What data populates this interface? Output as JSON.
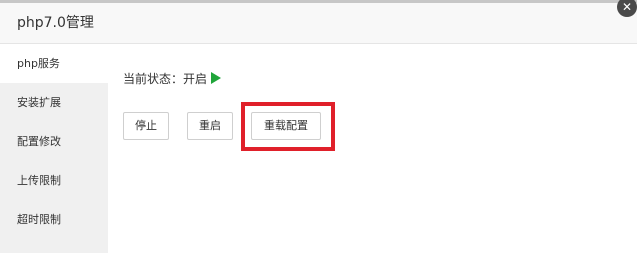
{
  "window": {
    "title": "php7.0管理",
    "close_glyph": "✕"
  },
  "sidebar": {
    "items": [
      {
        "label": "php服务",
        "active": true
      },
      {
        "label": "安装扩展",
        "active": false
      },
      {
        "label": "配置修改",
        "active": false
      },
      {
        "label": "上传限制",
        "active": false
      },
      {
        "label": "超时限制",
        "active": false
      }
    ]
  },
  "main": {
    "status_label": "当前状态：开启",
    "status_icon": "play-icon",
    "buttons": {
      "stop": "停止",
      "restart": "重启",
      "reload": "重载配置"
    }
  },
  "colors": {
    "status_on": "#20a53a",
    "highlight": "#e0202a",
    "sidebar_bg": "#f0f0f0"
  }
}
